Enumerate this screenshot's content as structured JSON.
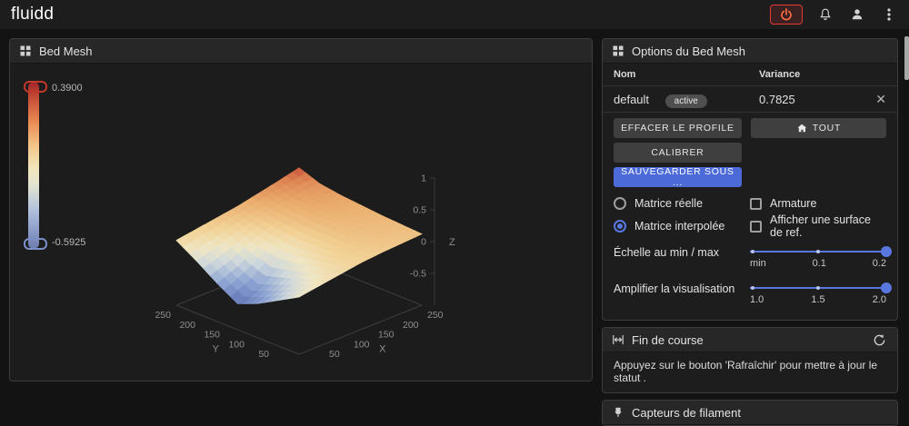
{
  "topbar": {
    "logo": "fluidd"
  },
  "panels": {
    "bed_mesh": {
      "title": "Bed Mesh",
      "colorbar_max": "0.3900",
      "colorbar_min": "-0.5925"
    },
    "options": {
      "title": "Options du Bed Mesh",
      "table": {
        "col_name": "Nom",
        "col_variance": "Variance",
        "profile": {
          "name": "default",
          "badge": "active",
          "variance": "0.7825",
          "close_icon": "✕"
        }
      },
      "buttons": {
        "clear_profile": "EFFACER LE PROFILE",
        "all": "TOUT",
        "calibrate": "CALIBRER",
        "save_as": "SAUVEGARDER SOUS ..."
      },
      "radios": [
        {
          "label": "Matrice réelle",
          "checked": false
        },
        {
          "label": "Matrice interpolée",
          "checked": true
        }
      ],
      "checkboxes": [
        {
          "label": "Armature",
          "checked": false
        },
        {
          "label": "Afficher une surface de ref.",
          "checked": false
        }
      ],
      "sliders": [
        {
          "label": "Échelle au min / max",
          "ticks": [
            "min",
            "0.1",
            "0.2"
          ],
          "value_fraction": 1
        },
        {
          "label": "Amplifier la visualisation",
          "ticks": [
            "1.0",
            "1.5",
            "2.0"
          ],
          "value_fraction": 1
        }
      ]
    },
    "endstops": {
      "title": "Fin de course",
      "message": "Appuyez sur le bouton 'Rafraîchir' pour mettre à jour le statut ."
    },
    "filament": {
      "title": "Capteurs de filament"
    }
  },
  "chart_data": {
    "type": "surface",
    "title": "Bed Mesh",
    "x_label": "X",
    "y_label": "Y",
    "z_label": "Z",
    "x_ticks": [
      50,
      100,
      150,
      200,
      250
    ],
    "y_ticks": [
      50,
      100,
      150,
      200,
      250
    ],
    "z_ticks": [
      -0.5,
      0,
      0.5,
      1
    ],
    "z_range": [
      -1,
      1
    ],
    "colorbar": {
      "max": 0.39,
      "min": -0.5925
    },
    "z_values": [
      [
        -0.1,
        -0.05,
        0.0,
        0.05,
        0.08,
        0.1,
        0.12
      ],
      [
        -0.28,
        -0.16,
        -0.03,
        0.06,
        0.1,
        0.13,
        0.14
      ],
      [
        -0.46,
        -0.3,
        -0.1,
        0.04,
        0.12,
        0.15,
        0.16
      ],
      [
        -0.5925,
        -0.42,
        -0.15,
        0.02,
        0.14,
        0.18,
        0.19
      ],
      [
        -0.4,
        -0.27,
        -0.08,
        0.06,
        0.16,
        0.21,
        0.22
      ],
      [
        -0.18,
        -0.08,
        0.03,
        0.11,
        0.19,
        0.24,
        0.27
      ],
      [
        0.02,
        0.07,
        0.12,
        0.17,
        0.24,
        0.31,
        0.39
      ]
    ]
  },
  "colors": {
    "accent": "#5878e0",
    "save_button": "#4c6bd8",
    "estop": "#e53935"
  }
}
